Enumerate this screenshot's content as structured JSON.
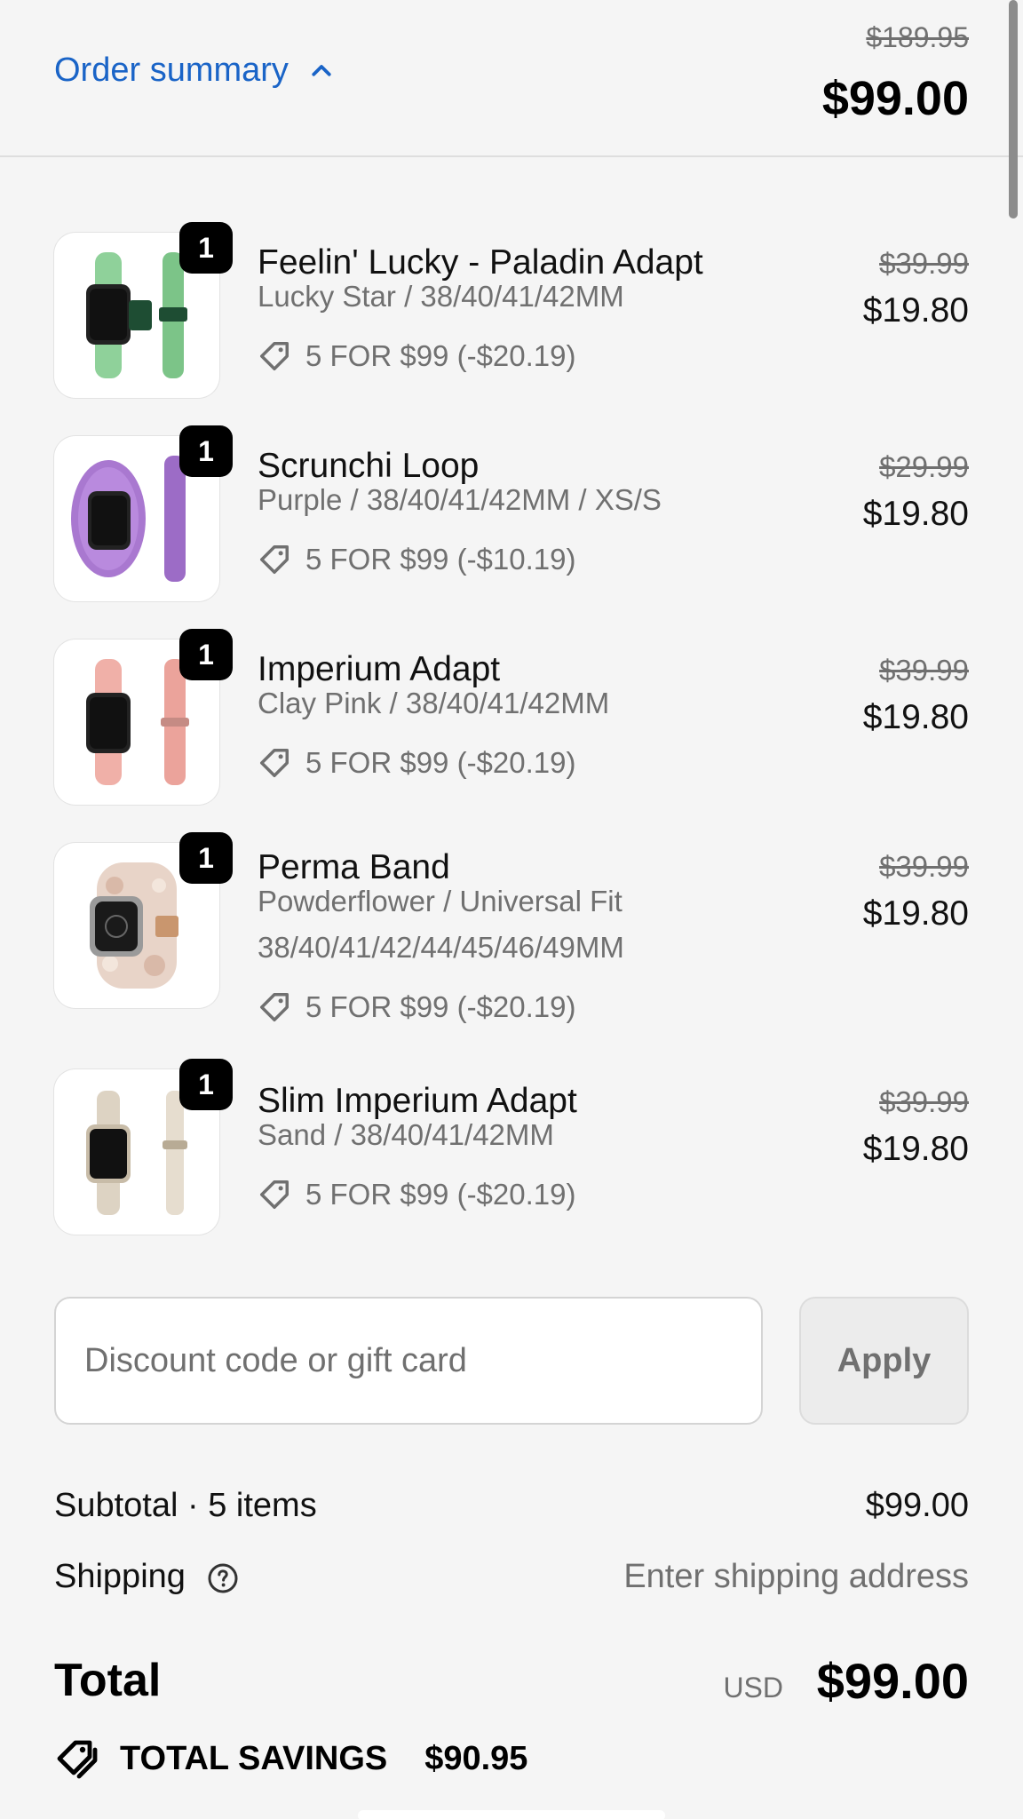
{
  "header": {
    "summary_label": "Order summary",
    "original_total": "$189.95",
    "total": "$99.00"
  },
  "items": [
    {
      "qty": "1",
      "name": "Feelin' Lucky - Paladin Adapt",
      "variant": "Lucky Star / 38/40/41/42MM",
      "variant2": "",
      "discount": "5 FOR $99 (-$20.19)",
      "original_price": "$39.99",
      "price": "$19.80",
      "image": "green-woven-watch-band"
    },
    {
      "qty": "1",
      "name": "Scrunchi Loop",
      "variant": "Purple / 38/40/41/42MM / XS/S",
      "variant2": "",
      "discount": "5 FOR $99 (-$10.19)",
      "original_price": "$29.99",
      "price": "$19.80",
      "image": "purple-scrunchie-watch-band"
    },
    {
      "qty": "1",
      "name": "Imperium Adapt",
      "variant": "Clay Pink / 38/40/41/42MM",
      "variant2": "",
      "discount": "5 FOR $99 (-$20.19)",
      "original_price": "$39.99",
      "price": "$19.80",
      "image": "pink-woven-watch-band"
    },
    {
      "qty": "1",
      "name": "Perma Band",
      "variant": "Powderflower / Universal Fit",
      "variant2": "38/40/41/42/44/45/46/49MM",
      "discount": "5 FOR $99 (-$20.19)",
      "original_price": "$39.99",
      "price": "$19.80",
      "image": "resin-link-watch-band"
    },
    {
      "qty": "1",
      "name": "Slim Imperium Adapt",
      "variant": "Sand / 38/40/41/42MM",
      "variant2": "",
      "discount": "5 FOR $99 (-$20.19)",
      "original_price": "$39.99",
      "price": "$19.80",
      "image": "sand-woven-watch-band"
    }
  ],
  "discount_field": {
    "placeholder": "Discount code or gift card",
    "apply_label": "Apply"
  },
  "subtotal": {
    "label": "Subtotal · 5 items",
    "value": "$99.00"
  },
  "shipping": {
    "label": "Shipping",
    "value": "Enter shipping address"
  },
  "total": {
    "label": "Total",
    "currency": "USD",
    "value": "$99.00"
  },
  "savings": {
    "label": "TOTAL SAVINGS",
    "value": "$90.95"
  },
  "colors": {
    "link": "#1a64c7",
    "muted": "#707070",
    "background": "#f5f5f5",
    "band_colors": [
      "#8fd19a",
      "#a978d0",
      "#f0b0a8",
      "#e8d4c8",
      "#ddd3c3"
    ]
  }
}
